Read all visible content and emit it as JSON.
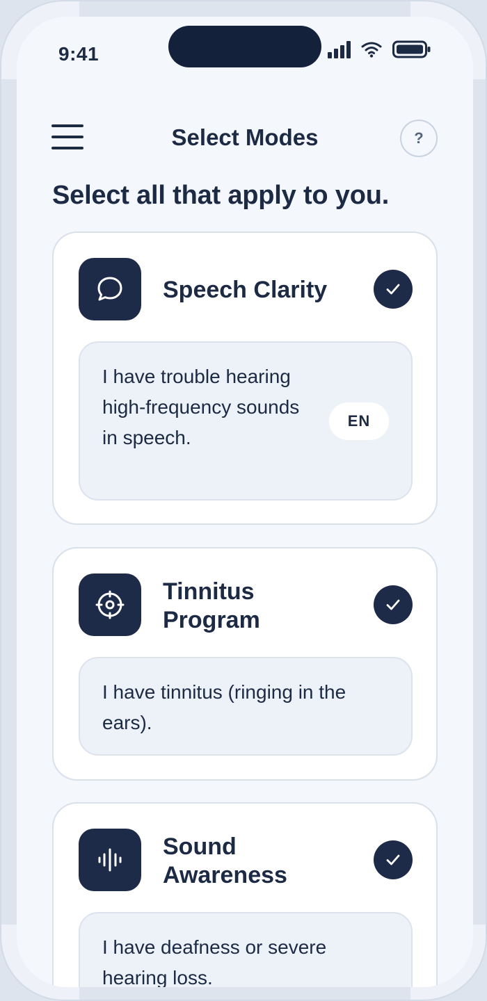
{
  "status_bar": {
    "time": "9:41"
  },
  "header": {
    "title": "Select Modes",
    "help_label": "?"
  },
  "prompt": "Select all that apply to you.",
  "modes": [
    {
      "title": "Speech Clarity",
      "icon": "chat-bubble-icon",
      "selected": true,
      "description": "I have trouble hearing high-frequency sounds in speech.",
      "language_badge": "EN"
    },
    {
      "title": "Tinnitus Program",
      "icon": "target-icon",
      "selected": true,
      "description": "I have tinnitus (ringing in the ears)."
    },
    {
      "title": "Sound Awareness",
      "icon": "sound-wave-icon",
      "selected": true,
      "description": "I have deafness or severe hearing loss."
    }
  ],
  "colors": {
    "accent": "#1e2b48",
    "background": "#f4f7fc",
    "card": "#ffffff",
    "description_box": "#edf1f8"
  }
}
